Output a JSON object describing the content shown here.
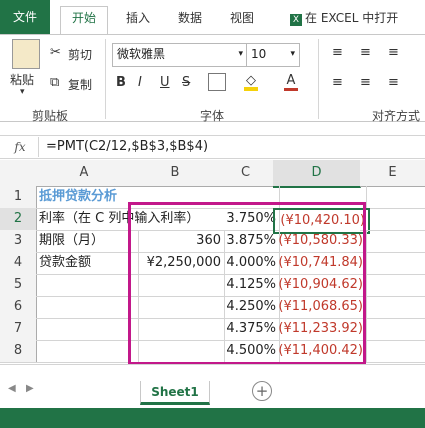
{
  "ribbon_tabs": [
    "文件",
    "开始",
    "插入",
    "数据",
    "视图",
    "在 EXCEL 中打开"
  ],
  "clipboard": {
    "paste": "粘贴",
    "cut": "剪切",
    "copy": "复制",
    "group": "剪贴板"
  },
  "font": {
    "name": "微软雅黑",
    "size": "10",
    "group": "字体"
  },
  "alignment": {
    "group": "对齐方式"
  },
  "formula": {
    "fx": "fx",
    "text": "=PMT(C2/12,$B$3,$B$4)"
  },
  "columns": [
    "A",
    "B",
    "C",
    "D",
    "E"
  ],
  "rows": [
    "1",
    "2",
    "3",
    "4",
    "5",
    "6",
    "7",
    "8"
  ],
  "cells": {
    "A1": "抵押贷款分析",
    "A2": "利率（在 C 列中输入利率）",
    "A3": "期限（月）",
    "B3": "360",
    "A4": "贷款金额",
    "B4": "¥2,250,000",
    "C": [
      "3.750%",
      "3.875%",
      "4.000%",
      "4.125%",
      "4.250%",
      "4.375%",
      "4.500%"
    ],
    "D": [
      "(¥10,420.10)",
      "(¥10,580.33)",
      "(¥10,741.84)",
      "(¥10,904.62)",
      "(¥11,068.65)",
      "(¥11,233.92)",
      "(¥11,400.42)"
    ]
  },
  "sheet": {
    "tab": "Sheet1"
  },
  "colors": {
    "accent": "#217346",
    "highlight_box": "#c2188a",
    "negative": "#c0392b",
    "title": "#5b9bd5"
  }
}
